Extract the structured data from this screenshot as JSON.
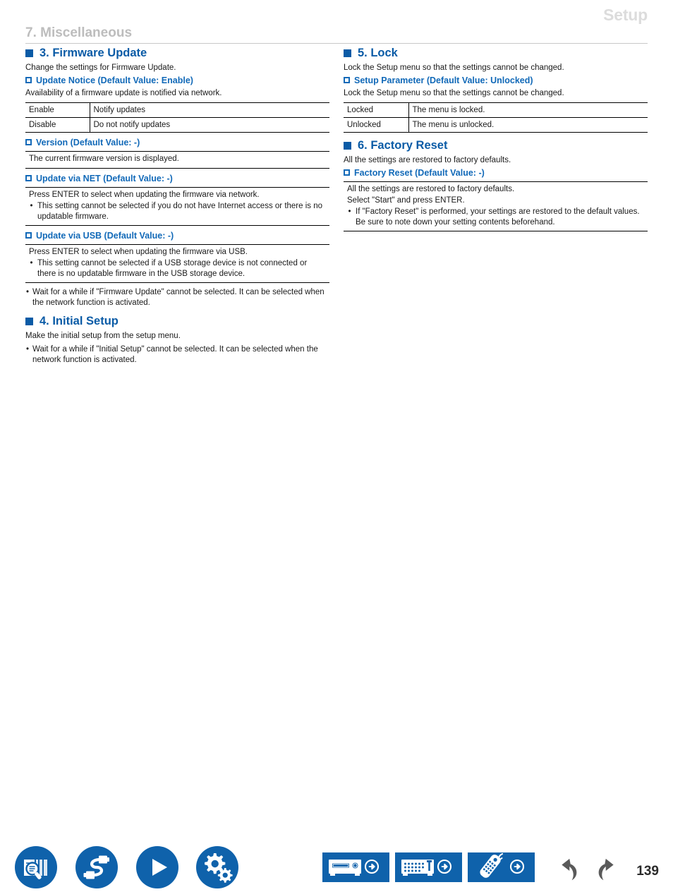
{
  "header": {
    "title": "Setup",
    "chapter": "7. Miscellaneous"
  },
  "left_column": {
    "section_firmware": {
      "heading": "3. Firmware Update",
      "intro": "Change the settings for Firmware Update.",
      "sub_update_notice": {
        "heading": "Update Notice (Default Value: Enable)",
        "desc": "Availability of a firmware update is notified via network.",
        "table": {
          "rows": [
            {
              "key": "Enable",
              "value": "Notify updates"
            },
            {
              "key": "Disable",
              "value": "Do not notify updates"
            }
          ]
        }
      },
      "sub_version": {
        "heading": "Version (Default Value: -)",
        "block_line1": "The current firmware version is displayed."
      },
      "sub_update_net": {
        "heading": "Update via NET (Default Value: -)",
        "block_line1": "Press ENTER to select when updating the firmware via network.",
        "block_bullet1": "This setting cannot be selected if you do not have Internet access or there is no updatable firmware."
      },
      "sub_update_usb": {
        "heading": "Update via USB (Default Value: -)",
        "block_line1": "Press ENTER to select when updating the firmware via USB.",
        "block_bullet1": "This setting cannot be selected if a USB storage device is not connected or there is no updatable firmware in the USB storage device."
      },
      "note_bullet": "Wait for a while if \"Firmware Update\" cannot be selected. It can be selected when the network function is activated."
    },
    "section_initial_setup": {
      "heading": "4. Initial Setup",
      "intro": "Make the initial setup from the setup menu.",
      "note_bullet": "Wait for a while if \"Initial Setup\" cannot be selected. It can be selected when the network function is activated."
    }
  },
  "right_column": {
    "section_lock": {
      "heading": "5. Lock",
      "intro": "Lock the Setup menu so that the settings cannot be changed.",
      "sub_setup_parameter": {
        "heading": "Setup Parameter (Default Value: Unlocked)",
        "desc": "Lock the Setup menu so that the settings cannot be changed.",
        "table": {
          "rows": [
            {
              "key": "Locked",
              "value": "The menu is locked."
            },
            {
              "key": "Unlocked",
              "value": "The menu is unlocked."
            }
          ]
        }
      }
    },
    "section_factory_reset": {
      "heading": "6. Factory Reset",
      "intro": "All the settings are restored to factory defaults.",
      "sub_factory_reset": {
        "heading": "Factory Reset (Default Value: -)",
        "block_line1": "All the settings are restored to factory defaults.",
        "block_line2": "Select \"Start\" and press ENTER.",
        "block_bullet1": "If \"Factory Reset\" is performed, your settings are restored to the default values. Be sure to note down your setting contents beforehand."
      }
    }
  },
  "footer": {
    "icons": [
      {
        "name": "manual-search-icon"
      },
      {
        "name": "connections-cable-icon"
      },
      {
        "name": "play-icon"
      },
      {
        "name": "setup-gears-icon"
      }
    ],
    "panel_buttons": [
      {
        "name": "front-panel-button"
      },
      {
        "name": "rear-panel-button"
      },
      {
        "name": "remote-controller-button"
      }
    ],
    "nav": {
      "back": "back-arrow-icon",
      "forward": "forward-arrow-icon"
    },
    "page_number": "139"
  },
  "colors": {
    "accent_blue": "#0a5ba6",
    "sub_blue": "#1169b8",
    "header_gray": "#dcdcdc",
    "chapter_gray": "#bdbdbd",
    "icon_blue": "#0f62ab",
    "nav_gray": "#5a5a5a"
  },
  "bullet_glyph": "•"
}
